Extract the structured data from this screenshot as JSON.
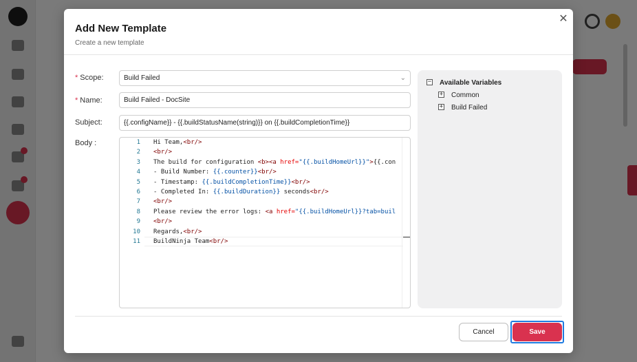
{
  "dialog": {
    "title": "Add New Template",
    "subtitle": "Create a new template",
    "close_glyph": "✕"
  },
  "form": {
    "scope": {
      "label": "Scope:",
      "required": true,
      "value": "Build Failed"
    },
    "name": {
      "label": "Name:",
      "required": true,
      "value": "Build Failed - DocSite"
    },
    "subject": {
      "label": "Subject:",
      "value": "{{.configName}} - {{.buildStatusName(string)}} on {{.buildCompletionTime}}"
    },
    "body": {
      "label": "Body :",
      "lines": [
        {
          "num": "1",
          "text": "Hi Team,<br/>"
        },
        {
          "num": "2",
          "text": "<br/>"
        },
        {
          "num": "3",
          "text": "The build for configuration <b><a href=\"{{.buildHomeUrl}}\">{{.con"
        },
        {
          "num": "4",
          "text": "- Build Number: {{.counter}}<br/>"
        },
        {
          "num": "5",
          "text": "- Timestamp: {{.buildCompletionTime}}<br/>"
        },
        {
          "num": "6",
          "text": "- Completed In: {{.buildDuration}} seconds<br/>"
        },
        {
          "num": "7",
          "text": "<br/>"
        },
        {
          "num": "8",
          "text": "Please review the error logs: <a href=\"{{.buildHomeUrl}}?tab=buil"
        },
        {
          "num": "9",
          "text": "<br/>"
        },
        {
          "num": "10",
          "text": "Regards,<br/>"
        },
        {
          "num": "11",
          "text": "BuildNinja Team<br/>"
        }
      ]
    }
  },
  "variables": {
    "title": "Available Variables",
    "items": [
      "Common",
      "Build Failed"
    ]
  },
  "footer": {
    "cancel_label": "Cancel",
    "save_label": "Save"
  },
  "colors": {
    "accent": "#d9324f",
    "focus_ring": "#1e7be0"
  }
}
